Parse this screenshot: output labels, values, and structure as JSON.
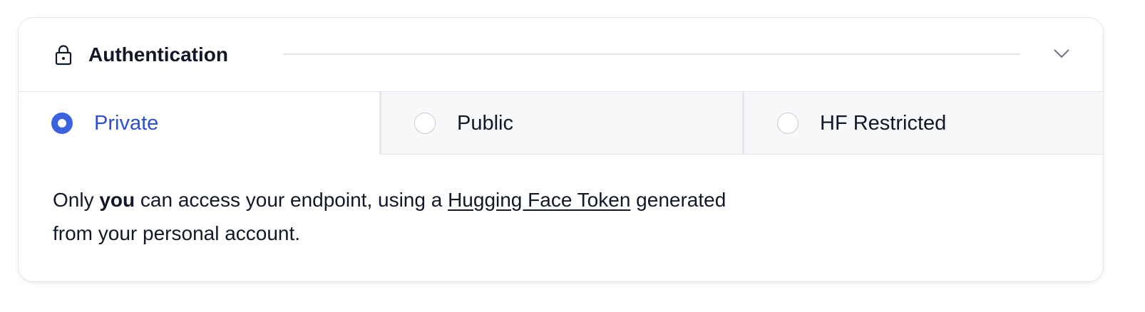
{
  "section": {
    "title": "Authentication",
    "lock_icon": "lock-icon",
    "chevron_icon": "chevron-down-icon"
  },
  "tabs": [
    {
      "label": "Private",
      "selected": true
    },
    {
      "label": "Public",
      "selected": false
    },
    {
      "label": "HF Restricted",
      "selected": false
    }
  ],
  "description": {
    "part1": "Only ",
    "bold": "you",
    "part2": " can access your endpoint, using a ",
    "link": "Hugging Face Token",
    "part3": " generated",
    "line2": "from your personal account."
  },
  "colors": {
    "accent": "#3b63e0",
    "accent_text": "#2d4fd1",
    "border": "#e5e7eb",
    "inactive_tab_bg": "#f7f8fa"
  }
}
